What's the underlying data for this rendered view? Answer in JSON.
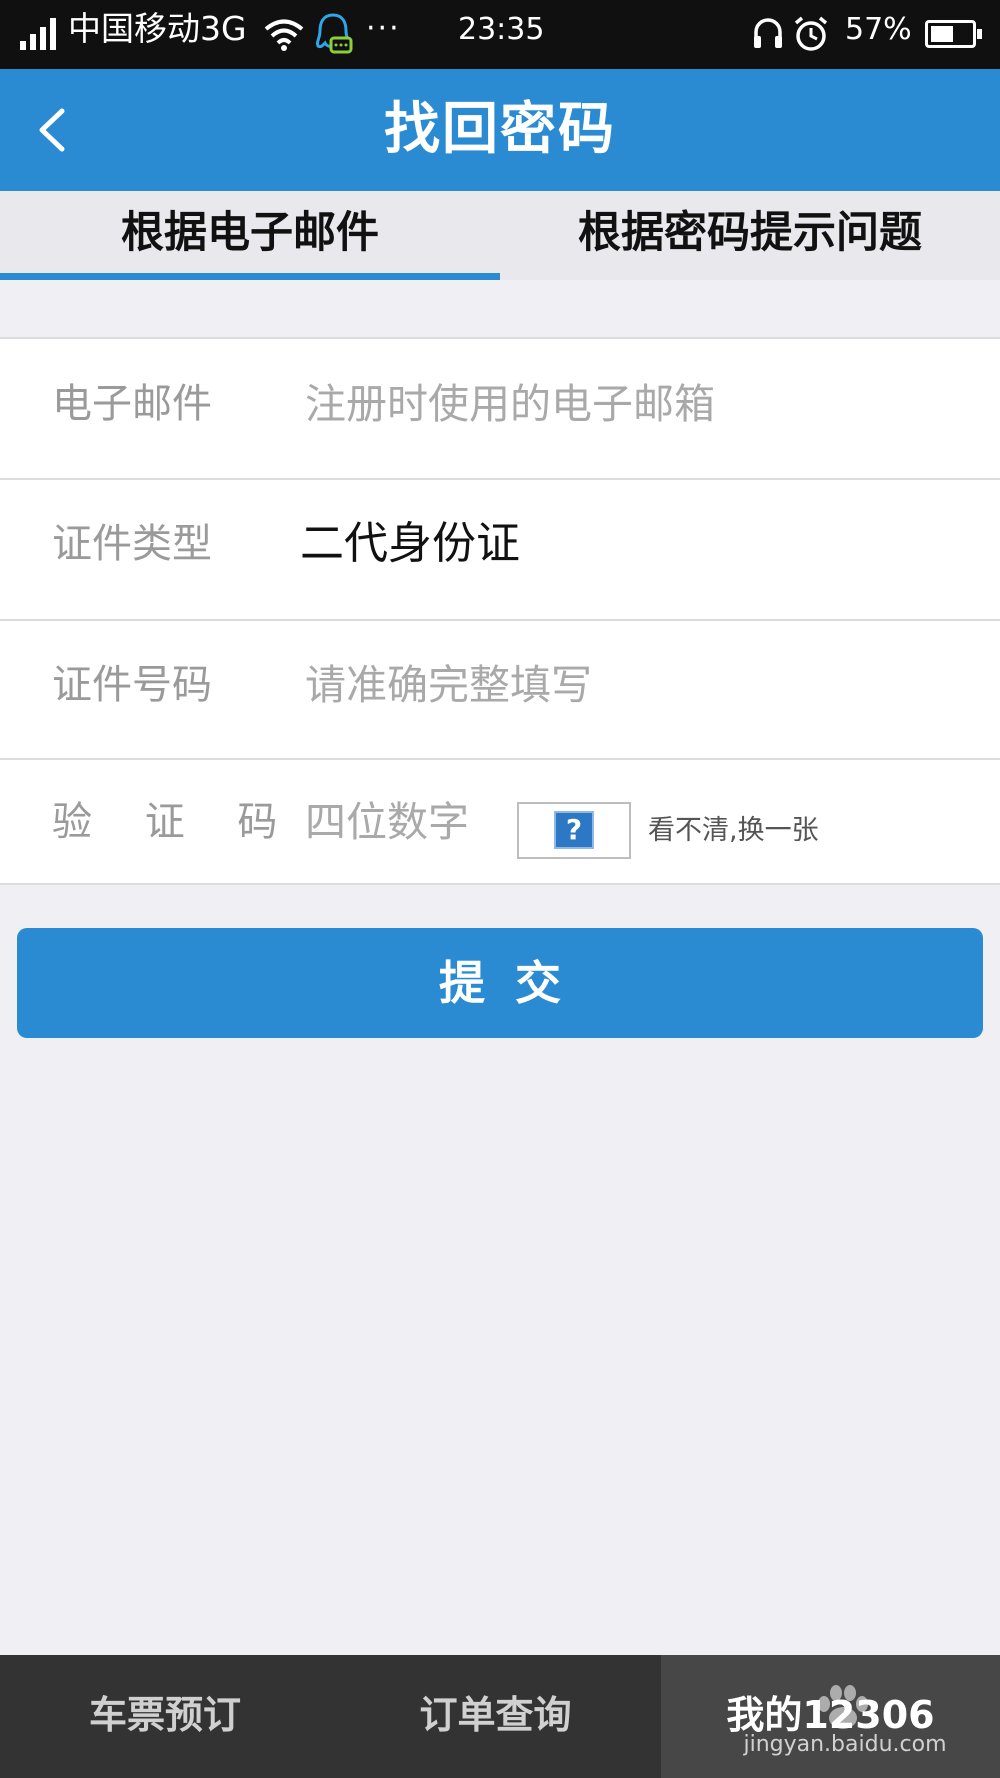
{
  "status_bar": {
    "carrier": "中国移动3G",
    "more": "···",
    "time": "23:35",
    "battery_percent": "57%",
    "battery_level": 0.57,
    "icons": [
      "signal-icon",
      "wifi-icon",
      "qq-icon",
      "headset-icon",
      "alarm-icon",
      "battery-icon"
    ]
  },
  "header": {
    "title": "找回密码",
    "back_icon": "chevron-left-icon"
  },
  "tabs": [
    {
      "label": "根据电子邮件",
      "active": true
    },
    {
      "label": "根据密码提示问题",
      "active": false
    }
  ],
  "form": {
    "email": {
      "label": "电子邮件",
      "placeholder": "注册时使用的电子邮箱"
    },
    "id_type": {
      "label": "证件类型",
      "value": "二代身份证"
    },
    "id_number": {
      "label": "证件号码",
      "placeholder": "请准确完整填写"
    },
    "captcha": {
      "label": "验 证 码",
      "placeholder": "四位数字",
      "image_icon": "?",
      "refresh_text": "看不清,换一张"
    }
  },
  "submit_label": "提交",
  "bottom_nav": [
    {
      "label": "车票预订",
      "active": false
    },
    {
      "label": "订单查询",
      "active": false
    },
    {
      "label": "我的12306",
      "active": true
    }
  ],
  "watermark": {
    "text": "jingyan.baidu.com"
  },
  "colors": {
    "accent": "#2a8bd2",
    "status_bar": "#101010",
    "background": "#efeff4",
    "bottom_nav": "#333333"
  }
}
